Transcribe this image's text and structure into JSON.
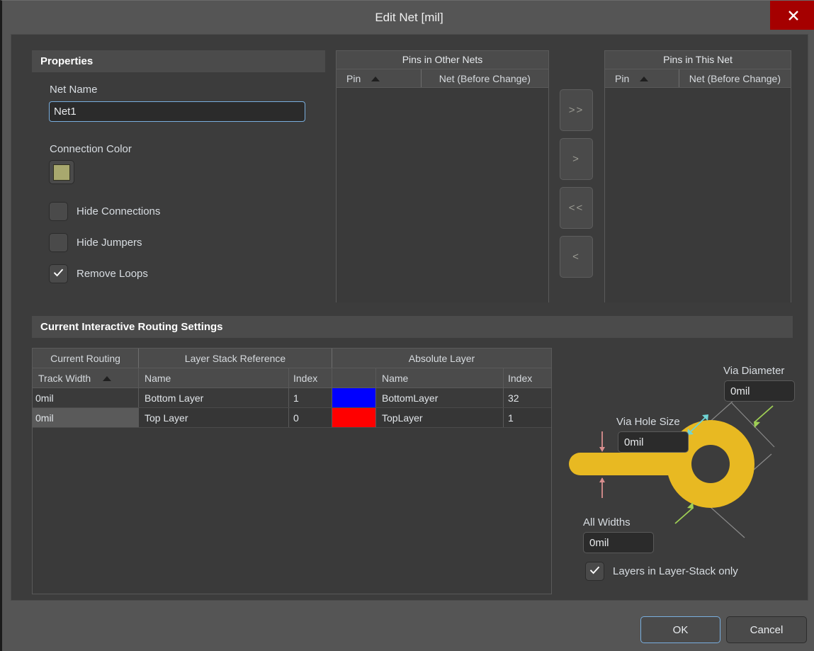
{
  "window": {
    "title": "Edit Net [mil]",
    "close_icon": "close-icon"
  },
  "properties": {
    "group_title": "Properties",
    "net_name_label": "Net Name",
    "net_name_value": "Net1",
    "connection_color_label": "Connection Color",
    "connection_color_hex": "#a8a86e",
    "checkboxes": [
      {
        "label": "Hide Connections",
        "checked": false
      },
      {
        "label": "Hide Jumpers",
        "checked": false
      },
      {
        "label": "Remove Loops",
        "checked": true
      }
    ]
  },
  "pins_other_nets": {
    "title": "Pins in Other Nets",
    "col_pin": "Pin",
    "col_net": "Net (Before Change)",
    "sort_indicator": "ascending",
    "rows": []
  },
  "pins_this_net": {
    "title": "Pins in This Net",
    "col_pin": "Pin",
    "col_net": "Net (Before Change)",
    "sort_indicator": "ascending",
    "rows": []
  },
  "transfer_buttons": [
    {
      "label": ">>",
      "name": "move-all-right-button"
    },
    {
      "label": ">",
      "name": "move-right-button"
    },
    {
      "label": "<<",
      "name": "move-all-left-button"
    },
    {
      "label": "<",
      "name": "move-left-button"
    }
  ],
  "routing": {
    "group_title": "Current Interactive Routing Settings",
    "group_headers": {
      "current_routing": "Current Routing",
      "layer_stack_reference": "Layer Stack Reference",
      "absolute_layer": "Absolute Layer"
    },
    "columns": {
      "track_width": "Track Width",
      "ls_name": "Name",
      "ls_index": "Index",
      "abs_name": "Name",
      "abs_index": "Index"
    },
    "rows": [
      {
        "track_width": "0mil",
        "ls_name": "Bottom Layer",
        "ls_index": "1",
        "color": "#0000ff",
        "abs_name": "BottomLayer",
        "abs_index": "32",
        "selected": false
      },
      {
        "track_width": "0mil",
        "ls_name": "Top Layer",
        "ls_index": "0",
        "color": "#ff0000",
        "abs_name": "TopLayer",
        "abs_index": "1",
        "selected": true
      }
    ]
  },
  "via": {
    "via_diameter_label": "Via Diameter",
    "via_diameter_value": "0mil",
    "via_hole_size_label": "Via Hole Size",
    "via_hole_size_value": "0mil",
    "all_widths_label": "All Widths",
    "all_widths_value": "0mil",
    "layers_only_label": "Layers in Layer-Stack only",
    "layers_only_checked": true,
    "diagram_color": "#e8b922",
    "track_arrow_color": "#d98f8f",
    "hole_arrow_color": "#6fd4d4",
    "diameter_arrow_color": "#9fcf55"
  },
  "footer": {
    "ok_label": "OK",
    "cancel_label": "Cancel"
  }
}
